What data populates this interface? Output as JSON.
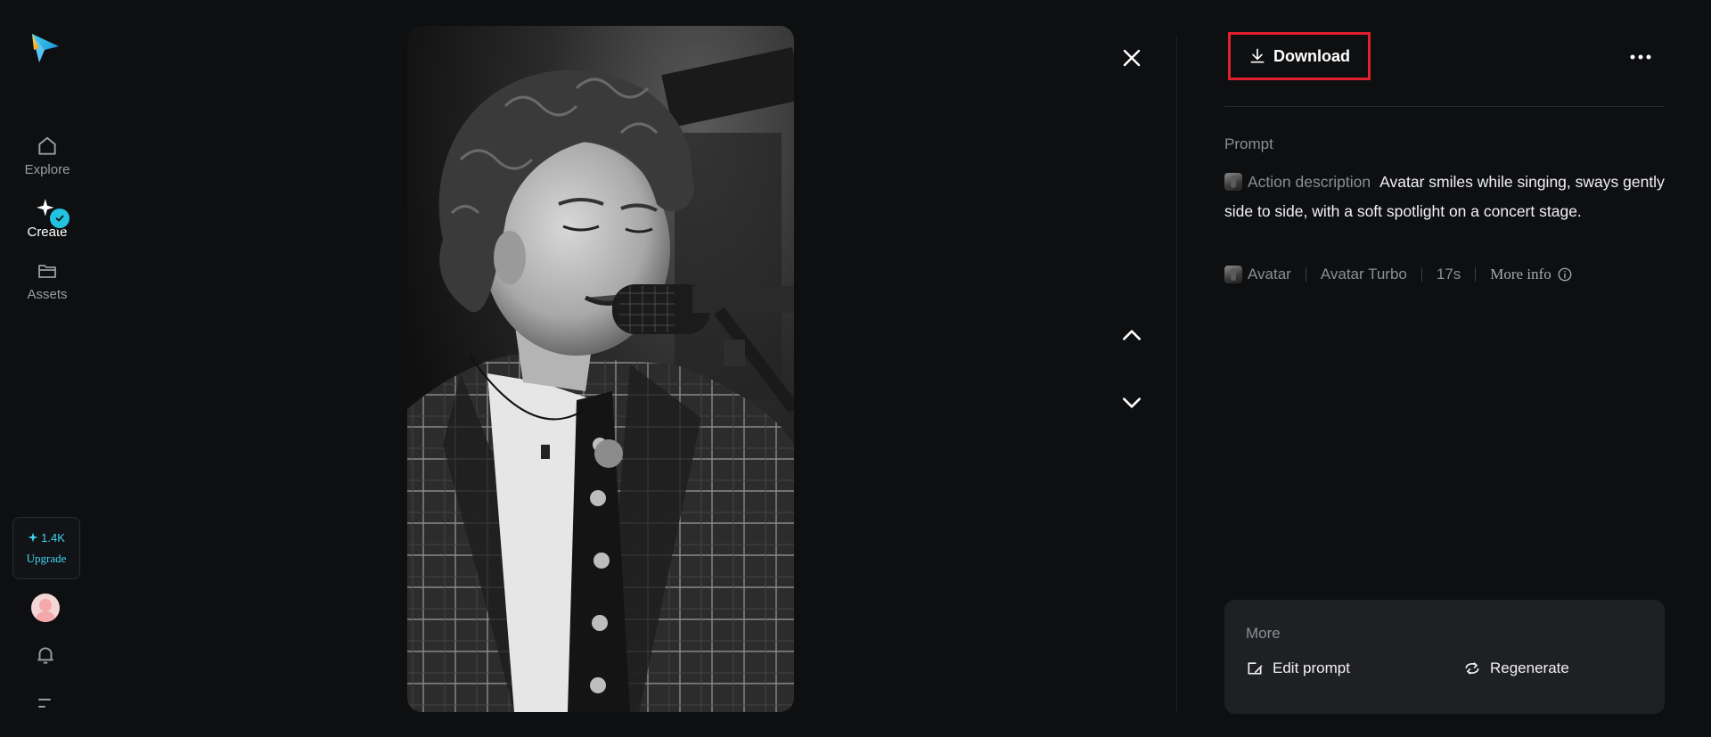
{
  "sidebar": {
    "logo": "app-logo",
    "items": [
      {
        "label": "Explore",
        "icon": "home-icon",
        "active": false
      },
      {
        "label": "Create",
        "icon": "sparkle-icon",
        "active": true
      },
      {
        "label": "Assets",
        "icon": "folder-icon",
        "active": false
      }
    ],
    "credits": "1.4K",
    "upgrade_label": "Upgrade",
    "accent_color": "#21c3e0"
  },
  "viewer": {
    "media_description_icon": "singer-photo",
    "controls": [
      "close-icon",
      "chevron-up-icon",
      "chevron-down-icon"
    ]
  },
  "panel": {
    "download_label": "Download",
    "more_menu_icon": "more-dots-icon",
    "prompt_label": "Prompt",
    "action_label": "Action description",
    "prompt_text": "Avatar smiles while singing, sways gently side to side, with a soft spotlight on a concert stage.",
    "meta": {
      "type": "Avatar",
      "model": "Avatar Turbo",
      "duration": "17s",
      "more_info": "More info"
    },
    "more": {
      "title": "More",
      "edit_label": "Edit prompt",
      "regenerate_label": "Regenerate"
    },
    "highlight_color": "#e0202d"
  }
}
